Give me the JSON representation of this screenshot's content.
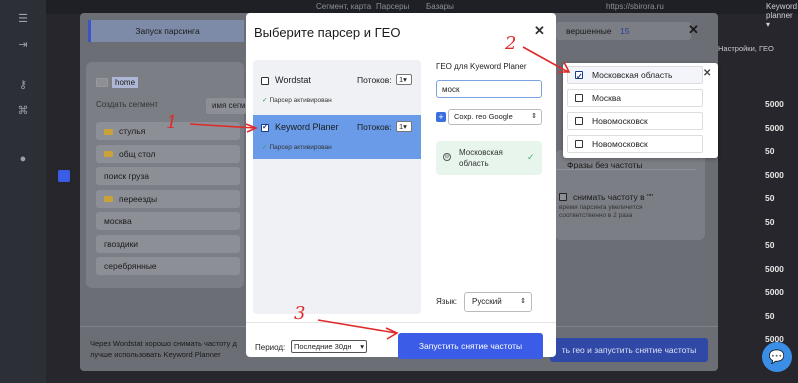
{
  "topbar": {
    "items": [
      "Сегмент, карта",
      "Парсеры",
      "Базары",
      "https://sbirora.ru",
      "Keyword planner ▾"
    ]
  },
  "background": {
    "launch_tab": "Запуск парсинга",
    "folder_home": "home",
    "create_segment_label": "Создать сегмент",
    "segment_name_placeholder": "имя сегм",
    "completed_label": "вершенные",
    "completed_count": "15",
    "settings_label": "Настройки, ГЕО",
    "segments": [
      {
        "label": "стулья",
        "folder": true
      },
      {
        "label": "общ стол",
        "folder": true
      },
      {
        "label": "поиск груза",
        "folder": false
      },
      {
        "label": "переезды",
        "folder": true
      },
      {
        "label": "москва",
        "folder": false
      },
      {
        "label": "гвоздики",
        "folder": false
      },
      {
        "label": "серебрянные",
        "folder": false
      }
    ],
    "numbers": [
      "5000",
      "5000",
      "50",
      "5000",
      "50",
      "50",
      "50",
      "5000",
      "5000",
      "50",
      "5000"
    ],
    "phrases_no_freq": "Фразы без частоты",
    "remove_freq_label": "снимать частоту в \"\"",
    "remove_freq_hint1": "время парсинга увеличится",
    "remove_freq_hint2": "соответственно в 2 раза",
    "hint_line1": "Через Wordstat хорошо снимать частоту д",
    "hint_line2": "лучше использовать Keyword Planner",
    "bg_button": "ть гео и запустить снятие частоты"
  },
  "modal": {
    "title": "Выберите парсер и ГЕО",
    "parsers": [
      {
        "name": "Wordstat",
        "threads_label": "Потоков:",
        "threads": "1",
        "status": "Парсер активирован",
        "checked": false,
        "selected": false
      },
      {
        "name": "Keyword Planer",
        "threads_label": "Потоков:",
        "threads": "1",
        "status": "Парсер активирован",
        "checked": true,
        "selected": true
      }
    ],
    "geo_label": "ГЕО для Kyeword Planer",
    "geo_input_value": "моск",
    "saved_geo_select": "Сохр. гео Google",
    "chosen_geo": "Московская область",
    "language_label": "Язык:",
    "language_value": "Русский",
    "period_label": "Период:",
    "period_value": "Последние 30дн",
    "run_button": "Запустить снятие частоты"
  },
  "dropdown": {
    "items": [
      {
        "label": "Московская область",
        "checked": true
      },
      {
        "label": "Москва",
        "checked": false
      },
      {
        "label": "Новомосковск",
        "checked": false
      },
      {
        "label": "Новомосковск",
        "checked": false
      }
    ]
  },
  "annotations": [
    "1",
    "2",
    "3"
  ]
}
